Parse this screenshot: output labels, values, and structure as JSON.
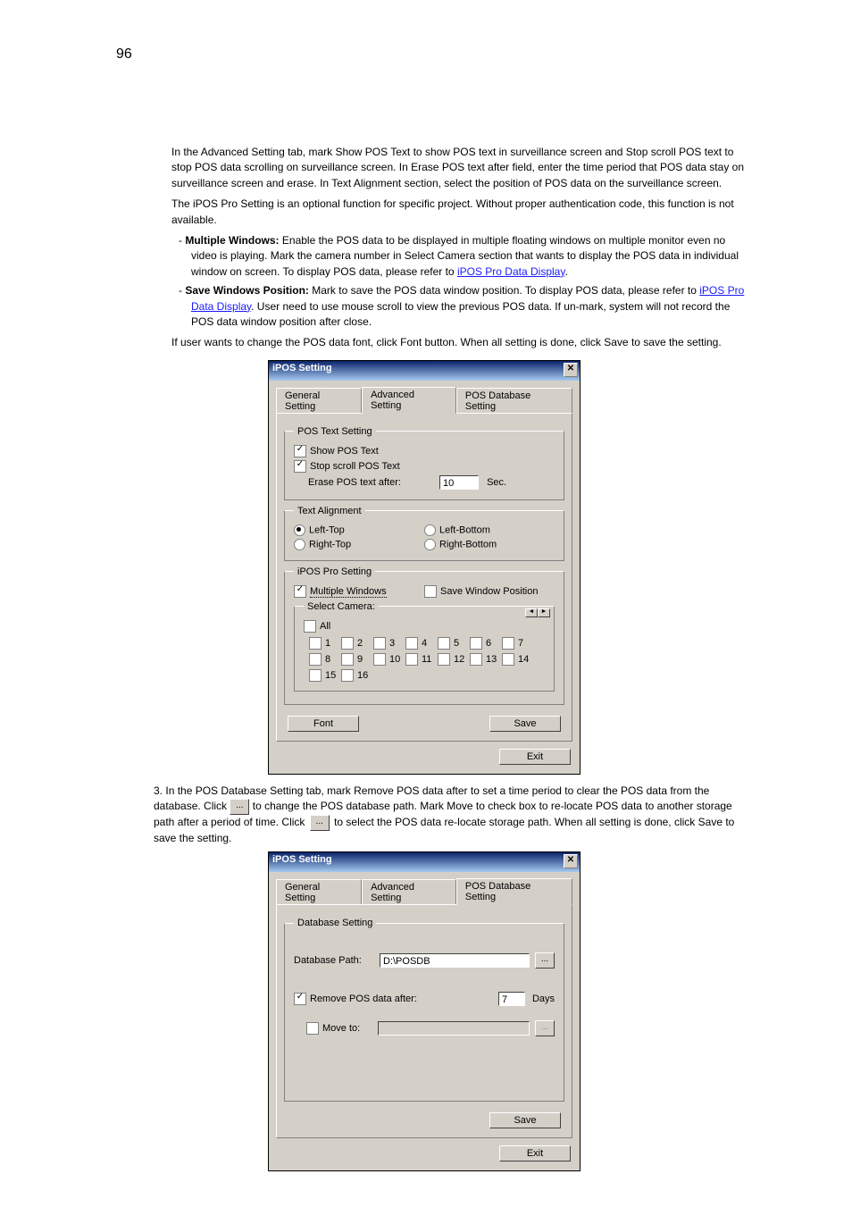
{
  "pageNumber": "96",
  "paragraphs": {
    "p1": "In the Advanced Setting tab, mark Show POS Text to show POS text in surveillance screen and Stop scroll POS text to stop POS data scrolling on surveillance screen. In Erase POS text after field, enter the time period that POS data stay on surveillance screen and erase. In Text Alignment section, select the position of POS data on the surveillance screen.",
    "p1b": "The iPOS Pro Setting is an optional function for specific project. Without proper authentication code, this function is not available.",
    "dash1b": "Multiple Windows:",
    "dash1t": " Enable the POS data to be displayed in multiple floating windows on multiple monitor even no video is playing. Mark the camera number in Select Camera section that wants to display the POS data in individual window on screen. To display POS data, please refer to ",
    "dash1link": "iPOS Pro Data Display",
    "dash1t2": ".",
    "dash2b": "Save Windows Position:",
    "dash2t": " Mark to save the POS data window position. To display POS data, please refer to ",
    "dash2link": "iPOS Pro Data Display",
    "dash2t2": ". User need to use mouse scroll to view the previous POS data. If un-mark, system will not record the POS data window position after close.",
    "p2": "If user wants to change the POS data font, click Font button. When all setting is done, click Save to save the setting.",
    "num3": "3.",
    "p3": "In the POS Database Setting tab, mark Remove POS data after to set a time period to clear the POS data from the database. Click ",
    "p3b": " to change the POS database path. Mark Move to check box to re-locate POS data to another storage path after a period of time. Click ",
    "p3c": " to select the POS data re-locate storage path. When all setting is done, click Save to save the setting."
  },
  "dialog1": {
    "title": "iPOS Setting",
    "tabs": [
      "General Setting",
      "Advanced Setting",
      "POS Database Setting"
    ],
    "activeTab": 1,
    "group1": {
      "legend": "POS Text Setting",
      "showPOS": "Show POS Text",
      "stopScroll": "Stop scroll POS Text",
      "eraseLabel": "Erase POS text after:",
      "eraseValue": "10",
      "sec": "Sec."
    },
    "group2": {
      "legend": "Text Alignment",
      "lt": "Left-Top",
      "rt": "Right-Top",
      "lb": "Left-Bottom",
      "rb": "Right-Bottom"
    },
    "group3": {
      "legend": "iPOS Pro Setting",
      "multiWin": "Multiple Windows",
      "saveWin": "Save Window Position",
      "selectCam": "Select Camera:",
      "all": "All",
      "cams": [
        "1",
        "2",
        "3",
        "4",
        "5",
        "6",
        "7",
        "8",
        "9",
        "10",
        "11",
        "12",
        "13",
        "14",
        "15",
        "16"
      ]
    },
    "fontBtn": "Font",
    "saveBtn": "Save",
    "exitBtn": "Exit"
  },
  "dialog2": {
    "title": "iPOS Setting",
    "tabs": [
      "General Setting",
      "Advanced Setting",
      "POS Database Setting"
    ],
    "activeTab": 2,
    "group": {
      "legend": "Database Setting",
      "dbPathLbl": "Database Path:",
      "dbPath": "D:\\POSDB",
      "removeLbl": "Remove POS data after:",
      "removeVal": "7",
      "days": "Days",
      "moveLbl": "Move to:"
    },
    "saveBtn": "Save",
    "exitBtn": "Exit"
  },
  "browseGlyph": "..."
}
